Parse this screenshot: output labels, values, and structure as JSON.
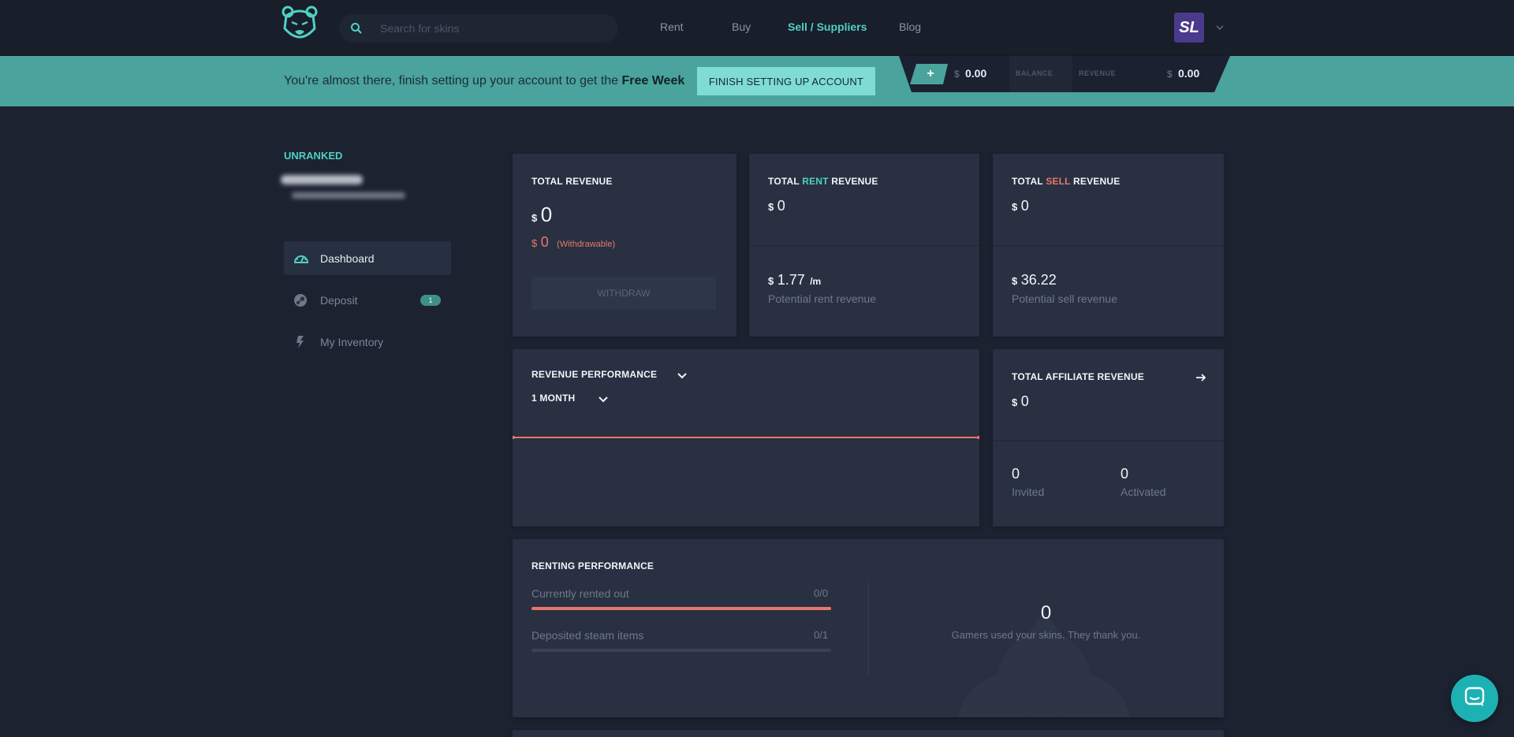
{
  "nav": {
    "search_placeholder": "Search for skins",
    "links": [
      "Rent",
      "Buy",
      "Sell / Suppliers",
      "Blog"
    ],
    "active_link": "Sell / Suppliers",
    "avatar_text": "SL"
  },
  "banner": {
    "message_prefix": "You're almost there, finish setting up your account to get the ",
    "message_bold": "Free Week",
    "finish_button": "FINISH SETTING UP ACCOUNT",
    "plus_label": "+",
    "balance_currency": "$",
    "balance_value": "0.00",
    "balance_label": "BALANCE",
    "revenue_label": "REVENUE",
    "revenue_currency": "$",
    "revenue_value": "0.00"
  },
  "sidebar": {
    "rank": "UNRANKED",
    "items": [
      {
        "label": "Dashboard",
        "icon": "dashboard-gauge-icon",
        "active": true
      },
      {
        "label": "Deposit",
        "icon": "steam-icon",
        "badge": "1"
      },
      {
        "label": "My Inventory",
        "icon": "lightning-icon"
      }
    ]
  },
  "cards": {
    "total_revenue": {
      "title": "TOTAL REVENUE",
      "currency": "$",
      "value": "0",
      "withdrawable_currency": "$",
      "withdrawable_value": "0",
      "withdrawable_label": "(Withdrawable)",
      "withdraw_button": "WITHDRAW"
    },
    "rent_revenue": {
      "title_prefix": "TOTAL ",
      "title_highlight": "RENT",
      "title_suffix": " REVENUE",
      "currency": "$",
      "value": "0",
      "potential_currency": "$",
      "potential_value": "1.77",
      "potential_unit": "/m",
      "potential_label": "Potential rent revenue"
    },
    "sell_revenue": {
      "title_prefix": "TOTAL ",
      "title_highlight": "SELL",
      "title_suffix": " REVENUE",
      "currency": "$",
      "value": "0",
      "potential_currency": "$",
      "potential_value": "36.22",
      "potential_label": "Potential sell revenue"
    },
    "revenue_performance": {
      "title": "REVENUE PERFORMANCE",
      "period": "1 MONTH"
    },
    "affiliate": {
      "title": "TOTAL AFFILIATE REVENUE",
      "currency": "$",
      "value": "0",
      "invited_value": "0",
      "invited_label": "Invited",
      "activated_value": "0",
      "activated_label": "Activated"
    },
    "renting_performance": {
      "title": "RENTING PERFORMANCE",
      "rented_label": "Currently rented out",
      "rented_value": "0/0",
      "rented_fraction": 1.0,
      "deposited_label": "Deposited steam items",
      "deposited_value": "0/1",
      "deposited_fraction": 0.0,
      "gamers_value": "0",
      "gamers_label": "Gamers used your skins. They thank you."
    }
  },
  "colors": {
    "accent": "#4fd1c5",
    "banner": "#4aa39c",
    "sell": "#e8776b",
    "background": "#1c2230",
    "card": "#283041"
  }
}
